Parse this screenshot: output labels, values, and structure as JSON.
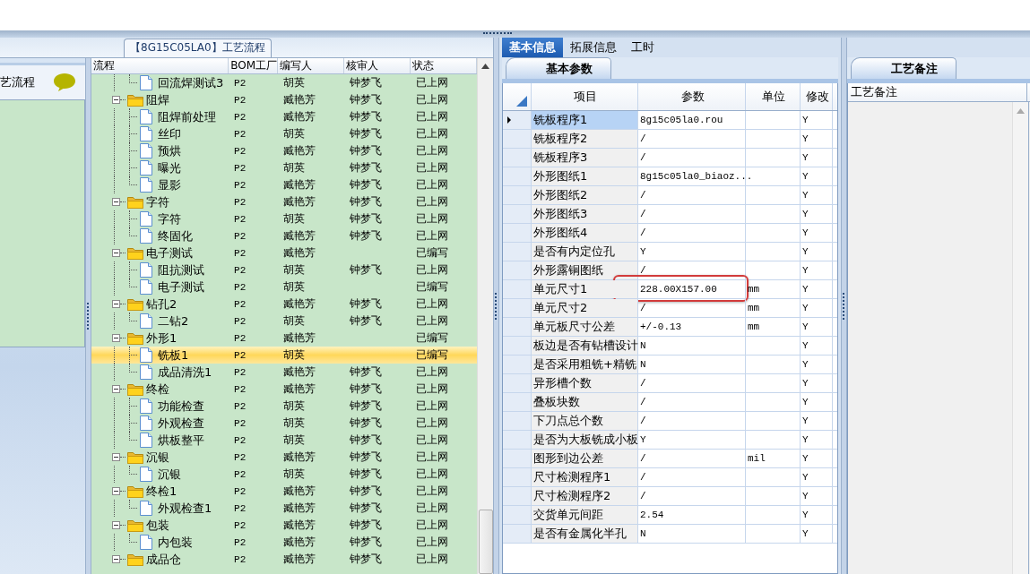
{
  "process_title": "【8G15C05LA0】工艺流程",
  "left_panel": {
    "title": "艺流程"
  },
  "tree": {
    "columns": [
      "流程",
      "BOM工厂",
      "编写人",
      "核审人",
      "状态"
    ],
    "rows": [
      {
        "kind": "leaf",
        "name": "回流焊测试3",
        "bom": "P2",
        "writer": "胡英",
        "reviewer": "钟梦飞",
        "status": "已上网",
        "selected": false
      },
      {
        "kind": "folder",
        "name": "阻焊",
        "bom": "P2",
        "writer": "臧艳芳",
        "reviewer": "钟梦飞",
        "status": "已上网",
        "selected": false,
        "expanded": true,
        "children": [
          {
            "kind": "leaf",
            "name": "阻焊前处理",
            "bom": "P2",
            "writer": "臧艳芳",
            "reviewer": "钟梦飞",
            "status": "已上网",
            "selected": false
          },
          {
            "kind": "leaf",
            "name": "丝印",
            "bom": "P2",
            "writer": "胡英",
            "reviewer": "钟梦飞",
            "status": "已上网",
            "selected": false
          },
          {
            "kind": "leaf",
            "name": "预烘",
            "bom": "P2",
            "writer": "臧艳芳",
            "reviewer": "钟梦飞",
            "status": "已上网",
            "selected": false
          },
          {
            "kind": "leaf",
            "name": "曝光",
            "bom": "P2",
            "writer": "胡英",
            "reviewer": "钟梦飞",
            "status": "已上网",
            "selected": false
          },
          {
            "kind": "leaf",
            "name": "显影",
            "bom": "P2",
            "writer": "臧艳芳",
            "reviewer": "钟梦飞",
            "status": "已上网",
            "selected": false
          }
        ]
      },
      {
        "kind": "folder",
        "name": "字符",
        "bom": "P2",
        "writer": "臧艳芳",
        "reviewer": "钟梦飞",
        "status": "已上网",
        "selected": false,
        "expanded": true,
        "children": [
          {
            "kind": "leaf",
            "name": "字符",
            "bom": "P2",
            "writer": "胡英",
            "reviewer": "钟梦飞",
            "status": "已上网",
            "selected": false
          },
          {
            "kind": "leaf",
            "name": "终固化",
            "bom": "P2",
            "writer": "臧艳芳",
            "reviewer": "钟梦飞",
            "status": "已上网",
            "selected": false
          }
        ]
      },
      {
        "kind": "folder",
        "name": "电子测试",
        "bom": "P2",
        "writer": "臧艳芳",
        "status": "已编写",
        "selected": false,
        "expanded": true,
        "children": [
          {
            "kind": "leaf",
            "name": "阻抗测试",
            "bom": "P2",
            "writer": "胡英",
            "reviewer": "钟梦飞",
            "status": "已上网",
            "selected": false
          },
          {
            "kind": "leaf",
            "name": "电子测试",
            "bom": "P2",
            "writer": "胡英",
            "status": "已编写",
            "selected": false
          }
        ]
      },
      {
        "kind": "folder",
        "name": "钻孔2",
        "bom": "P2",
        "writer": "臧艳芳",
        "reviewer": "钟梦飞",
        "status": "已上网",
        "selected": false,
        "expanded": true,
        "children": [
          {
            "kind": "leaf",
            "name": "二钻2",
            "bom": "P2",
            "writer": "胡英",
            "reviewer": "钟梦飞",
            "status": "已上网",
            "selected": false
          }
        ]
      },
      {
        "kind": "folder",
        "name": "外形1",
        "bom": "P2",
        "writer": "臧艳芳",
        "status": "已编写",
        "selected": false,
        "expanded": true,
        "children": [
          {
            "kind": "leaf",
            "name": "铣板1",
            "bom": "P2",
            "writer": "胡英",
            "status": "已编写",
            "selected": true
          },
          {
            "kind": "leaf",
            "name": "成品清洗1",
            "bom": "P2",
            "writer": "臧艳芳",
            "reviewer": "钟梦飞",
            "status": "已上网",
            "selected": false
          }
        ]
      },
      {
        "kind": "folder",
        "name": "终检",
        "bom": "P2",
        "writer": "臧艳芳",
        "reviewer": "钟梦飞",
        "status": "已上网",
        "selected": false,
        "expanded": true,
        "children": [
          {
            "kind": "leaf",
            "name": "功能检查",
            "bom": "P2",
            "writer": "胡英",
            "reviewer": "钟梦飞",
            "status": "已上网",
            "selected": false
          },
          {
            "kind": "leaf",
            "name": "外观检查",
            "bom": "P2",
            "writer": "胡英",
            "reviewer": "钟梦飞",
            "status": "已上网",
            "selected": false
          },
          {
            "kind": "leaf",
            "name": "烘板整平",
            "bom": "P2",
            "writer": "胡英",
            "reviewer": "钟梦飞",
            "status": "已上网",
            "selected": false
          }
        ]
      },
      {
        "kind": "folder",
        "name": "沉银",
        "bom": "P2",
        "writer": "臧艳芳",
        "reviewer": "钟梦飞",
        "status": "已上网",
        "selected": false,
        "expanded": true,
        "children": [
          {
            "kind": "leaf",
            "name": "沉银",
            "bom": "P2",
            "writer": "胡英",
            "reviewer": "钟梦飞",
            "status": "已上网",
            "selected": false
          }
        ]
      },
      {
        "kind": "folder",
        "name": "终检1",
        "bom": "P2",
        "writer": "臧艳芳",
        "reviewer": "钟梦飞",
        "status": "已上网",
        "selected": false,
        "expanded": true,
        "children": [
          {
            "kind": "leaf",
            "name": "外观检查1",
            "bom": "P2",
            "writer": "臧艳芳",
            "reviewer": "钟梦飞",
            "status": "已上网",
            "selected": false
          }
        ]
      },
      {
        "kind": "folder",
        "name": "包装",
        "bom": "P2",
        "writer": "臧艳芳",
        "reviewer": "钟梦飞",
        "status": "已上网",
        "selected": false,
        "expanded": true,
        "children": [
          {
            "kind": "leaf",
            "name": "内包装",
            "bom": "P2",
            "writer": "臧艳芳",
            "reviewer": "钟梦飞",
            "status": "已上网",
            "selected": false
          }
        ]
      },
      {
        "kind": "folder",
        "name": "成品仓",
        "bom": "P2",
        "writer": "臧艳芳",
        "reviewer": "钟梦飞",
        "status": "已上网",
        "selected": false,
        "expanded": true
      }
    ]
  },
  "tabs": [
    {
      "label": "基本信息",
      "selected": true
    },
    {
      "label": "拓展信息",
      "selected": false
    },
    {
      "label": "工时",
      "selected": false
    }
  ],
  "param_tabs": [
    {
      "label": "基本参数",
      "selected": true
    }
  ],
  "params": {
    "columns": [
      "项目",
      "参数",
      "单位",
      "修改"
    ],
    "rows": [
      {
        "item": "铣板程序1",
        "value": "8g15c05la0.rou",
        "modify": "Y",
        "current": true,
        "highlighted": false
      },
      {
        "item": "铣板程序2",
        "value": "/",
        "modify": "Y",
        "current": false,
        "highlighted": false
      },
      {
        "item": "铣板程序3",
        "value": "/",
        "modify": "Y",
        "current": false,
        "highlighted": false
      },
      {
        "item": "外形图纸1",
        "value": "8g15c05la0_biaoz...",
        "modify": "Y",
        "current": false,
        "highlighted": false
      },
      {
        "item": "外形图纸2",
        "value": "/",
        "modify": "Y",
        "current": false,
        "highlighted": false
      },
      {
        "item": "外形图纸3",
        "value": "/",
        "modify": "Y",
        "current": false,
        "highlighted": false
      },
      {
        "item": "外形图纸4",
        "value": "/",
        "modify": "Y",
        "current": false,
        "highlighted": false
      },
      {
        "item": "是否有内定位孔",
        "value": "Y",
        "modify": "Y",
        "current": false,
        "highlighted": false
      },
      {
        "item": "外形露铜图纸",
        "value": "/",
        "modify": "Y",
        "current": false,
        "highlighted": false
      },
      {
        "item": "单元尺寸1",
        "value": "228.00X157.00",
        "unit": "mm",
        "modify": "Y",
        "current": false,
        "highlighted": true
      },
      {
        "item": "单元尺寸2",
        "value": "/",
        "unit": "mm",
        "modify": "Y",
        "current": false,
        "highlighted": false
      },
      {
        "item": "单元板尺寸公差",
        "value": "+/-0.13",
        "unit": "mm",
        "modify": "Y",
        "current": false,
        "highlighted": false
      },
      {
        "item": "板边是否有钻槽设计",
        "value": "N",
        "modify": "Y",
        "current": false,
        "highlighted": false
      },
      {
        "item": "是否采用粗铣+精铣",
        "value": "N",
        "modify": "Y",
        "current": false,
        "highlighted": false
      },
      {
        "item": "异形槽个数",
        "value": "/",
        "modify": "Y",
        "current": false,
        "highlighted": false
      },
      {
        "item": "叠板块数",
        "value": "/",
        "modify": "Y",
        "current": false,
        "highlighted": false
      },
      {
        "item": "下刀点总个数",
        "value": "/",
        "modify": "Y",
        "current": false,
        "highlighted": false
      },
      {
        "item": "是否为大板铣成小板",
        "value": "Y",
        "modify": "Y",
        "current": false,
        "highlighted": false
      },
      {
        "item": "图形到边公差",
        "value": "/",
        "unit": "mil",
        "modify": "Y",
        "current": false,
        "highlighted": false
      },
      {
        "item": "尺寸检测程序1",
        "value": "/",
        "modify": "Y",
        "current": false,
        "highlighted": false
      },
      {
        "item": "尺寸检测程序2",
        "value": "/",
        "modify": "Y",
        "current": false,
        "highlighted": false
      },
      {
        "item": "交货单元间距",
        "value": "2.54",
        "modify": "Y",
        "current": false,
        "highlighted": false
      },
      {
        "item": "是否有金属化半孔",
        "value": "N",
        "modify": "Y",
        "current": false,
        "highlighted": false
      }
    ]
  },
  "notes": {
    "tab": "工艺备注",
    "column": "工艺备注"
  }
}
